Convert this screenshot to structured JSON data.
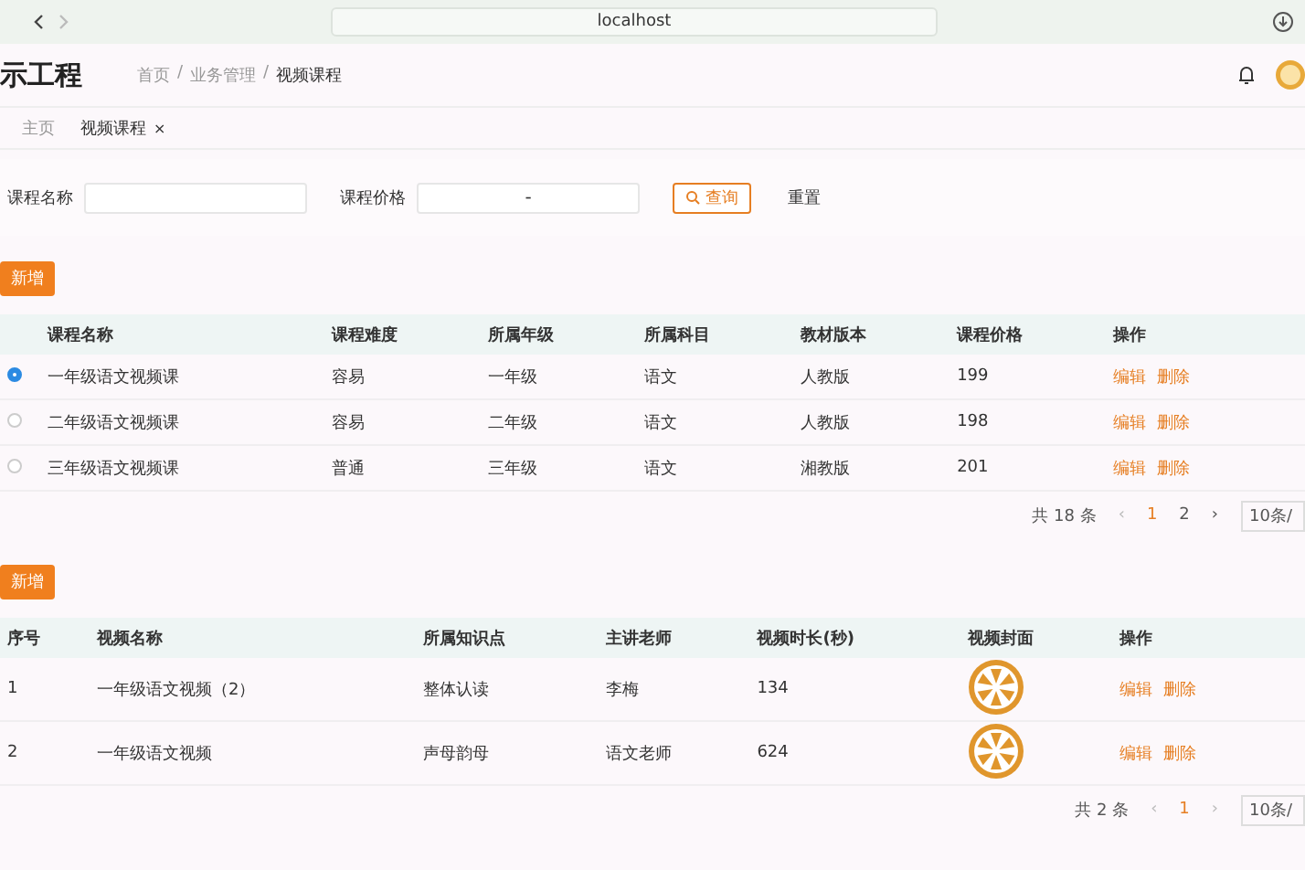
{
  "browser": {
    "address": "localhost"
  },
  "header": {
    "title": "示工程",
    "breadcrumb": [
      "首页",
      "业务管理",
      "视频课程"
    ],
    "separator": "/"
  },
  "tabs": [
    {
      "label": "主页",
      "selected": false
    },
    {
      "label": "视频课程",
      "selected": true,
      "close": "×"
    }
  ],
  "search": {
    "fields": [
      {
        "label": "课程名称",
        "kind": "text"
      },
      {
        "label": "课程价格",
        "kind": "range",
        "separator": "-"
      }
    ],
    "search_button": "查询",
    "reset_button": "重置"
  },
  "courses": {
    "add_button": "新增",
    "columns": [
      "课程名称",
      "课程难度",
      "所属年级",
      "所属科目",
      "教材版本",
      "课程价格",
      "操作"
    ],
    "rows": [
      {
        "selected": true,
        "cells": [
          "一年级语文视频课",
          "容易",
          "一年级",
          "语文",
          "人教版",
          "199"
        ],
        "actions": [
          "编辑",
          "删除"
        ]
      },
      {
        "selected": false,
        "cells": [
          "二年级语文视频课",
          "容易",
          "二年级",
          "语文",
          "人教版",
          "198"
        ],
        "actions": [
          "编辑",
          "删除"
        ]
      },
      {
        "selected": false,
        "cells": [
          "三年级语文视频课",
          "普通",
          "三年级",
          "语文",
          "湘教版",
          "201"
        ],
        "actions": [
          "编辑",
          "删除"
        ]
      }
    ],
    "pagination": {
      "total": "共 18 条",
      "prev": "‹",
      "pages": [
        {
          "label": "1",
          "selected": true
        },
        {
          "label": "2",
          "selected": false
        }
      ],
      "next": "›",
      "size": "10条/"
    }
  },
  "videos": {
    "add_button": "新增",
    "columns": [
      "序号",
      "视频名称",
      "所属知识点",
      "主讲老师",
      "视频时长(秒)",
      "视频封面",
      "操作"
    ],
    "rows": [
      {
        "cells": [
          "1",
          "一年级语文视频（2）",
          "整体认读",
          "李梅",
          "134"
        ],
        "actions": [
          "编辑",
          "删除"
        ]
      },
      {
        "cells": [
          "2",
          "一年级语文视频",
          "声母韵母",
          "语文老师",
          "624"
        ],
        "actions": [
          "编辑",
          "删除"
        ]
      }
    ],
    "pagination": {
      "total": "共 2 条",
      "prev": "‹",
      "pages": [
        {
          "label": "1",
          "selected": true
        }
      ],
      "next": "›",
      "size": "10条/"
    }
  }
}
